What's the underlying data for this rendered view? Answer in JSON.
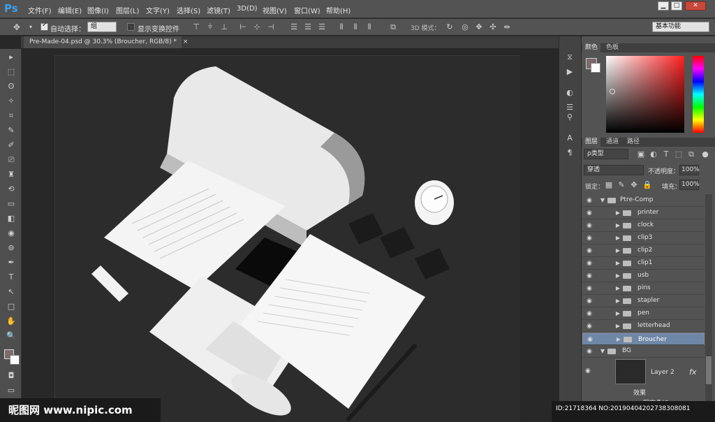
{
  "app": {
    "logo": "Ps"
  },
  "menu": [
    "文件(F)",
    "编辑(E)",
    "图像(I)",
    "图层(L)",
    "文字(Y)",
    "选择(S)",
    "滤镜(T)",
    "3D(D)",
    "视图(V)",
    "窗口(W)",
    "帮助(H)"
  ],
  "window_buttons": [
    "▁",
    "□",
    "✕"
  ],
  "options": {
    "auto_select_label": "自动选择：",
    "auto_select_value": "组",
    "show_transform_label": "显示变换控件",
    "mode_3d_label": "3D 模式：",
    "workspace": "基本功能"
  },
  "document": {
    "tab_title": "Pre-Made-04.psd @ 30.3% (Broucher, RGB/8) *",
    "tab_close": "×"
  },
  "tools": [
    "▸",
    "⬚",
    "ʘ",
    "✧",
    "⌗",
    "✎",
    "✐",
    "⎚",
    "♜",
    "⟲",
    "▭",
    "◧",
    "◉",
    "⊚",
    "✒",
    "T",
    "↖",
    "□",
    "✋",
    "🔍"
  ],
  "color_panel": {
    "tabs": [
      "颜色",
      "色板"
    ]
  },
  "layers_panel": {
    "tabs": [
      "图层",
      "通道",
      "路径"
    ],
    "filter": "ρ类型",
    "blend_mode": "穿透",
    "opacity_label": "不透明度：",
    "opacity": "100%",
    "lock_label": "锁定：",
    "fill_label": "填充：",
    "fill": "100%",
    "layers": [
      {
        "name": "Ptre-Comp",
        "level": 0,
        "open": true
      },
      {
        "name": "printer",
        "level": 1
      },
      {
        "name": "clock",
        "level": 1
      },
      {
        "name": "clip3",
        "level": 1
      },
      {
        "name": "clip2",
        "level": 1
      },
      {
        "name": "clip1",
        "level": 1
      },
      {
        "name": "usb",
        "level": 1
      },
      {
        "name": "pins",
        "level": 1
      },
      {
        "name": "stapler",
        "level": 1
      },
      {
        "name": "pen",
        "level": 1
      },
      {
        "name": "letterhead",
        "level": 1
      },
      {
        "name": "Broucher",
        "level": 1,
        "selected": true
      },
      {
        "name": "BG",
        "level": 0,
        "open": true
      }
    ],
    "layer2": {
      "name": "Layer 2",
      "fx": "fx",
      "effects": "效果",
      "overlay": "图案叠加"
    }
  },
  "watermark": {
    "site": "昵图网 www.nipic.com",
    "id": "ID:21718364 NO:20190404202738308081"
  },
  "colors": {
    "accent": "#3ea0e8",
    "selected_layer": "#6f87a6"
  }
}
